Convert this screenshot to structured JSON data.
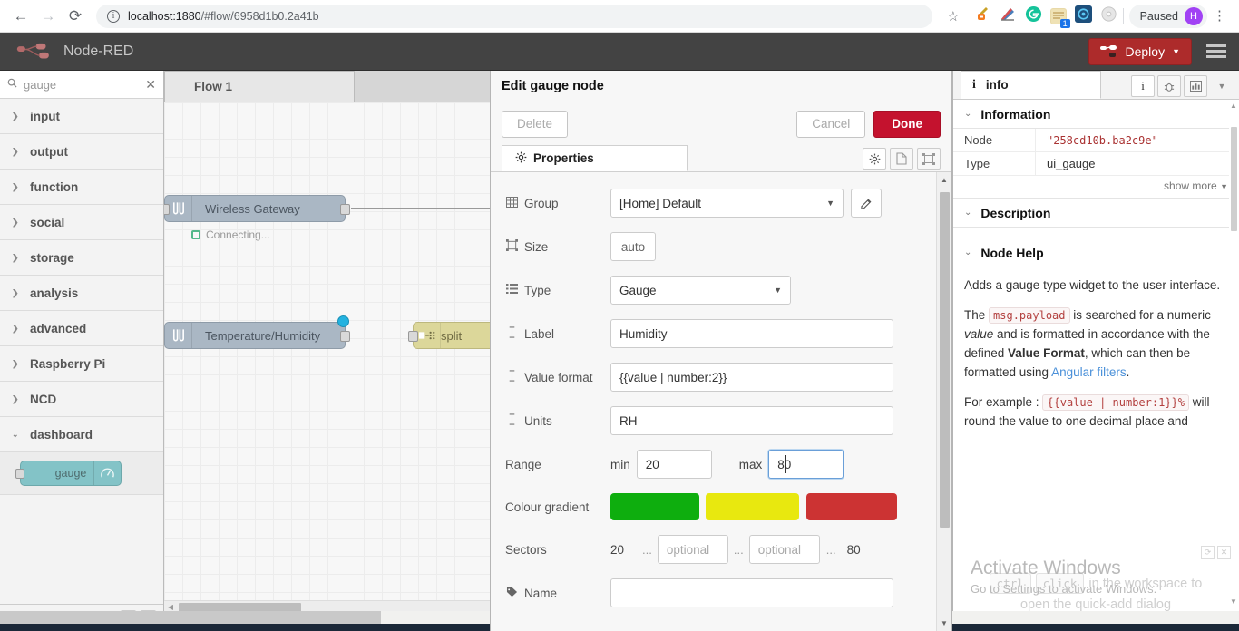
{
  "browser": {
    "back_icon": "back-arrow",
    "forward_icon": "forward-arrow",
    "reload_icon": "reload",
    "url_prefix": "localhost:1880",
    "url_suffix": "/#flow/6958d1b0.2a41b",
    "url_full": "localhost:1880/#flow/6958d1b0.2a41b",
    "star_glyph": "☆",
    "profile_status": "Paused",
    "profile_initial": "H",
    "extension_badge": "1",
    "kebab_glyph": "⋮"
  },
  "header": {
    "title": "Node-RED",
    "deploy_label": "Deploy",
    "deploy_color": "#ad2b2b"
  },
  "palette": {
    "search_value": "gauge",
    "search_clear": "✕",
    "categories": [
      {
        "label": "input",
        "open": false
      },
      {
        "label": "output",
        "open": false
      },
      {
        "label": "function",
        "open": false
      },
      {
        "label": "social",
        "open": false
      },
      {
        "label": "storage",
        "open": false
      },
      {
        "label": "analysis",
        "open": false
      },
      {
        "label": "advanced",
        "open": false
      },
      {
        "label": "Raspberry Pi",
        "open": false
      },
      {
        "label": "NCD",
        "open": false
      },
      {
        "label": "dashboard",
        "open": true
      }
    ],
    "nodes": [
      {
        "label": "gauge",
        "icon": "gauge-icon",
        "color": "#83c3c7"
      }
    ],
    "footer_up": "▲",
    "footer_down": "▼"
  },
  "workspace": {
    "tab_label": "Flow 1",
    "nodes": [
      {
        "label": "Wireless Gateway",
        "status": "Connecting...",
        "color": "#aab7c4"
      },
      {
        "label": "Temperature/Humidity",
        "color": "#aab7c4"
      },
      {
        "label": "split",
        "color": "#dcd79a"
      }
    ]
  },
  "dialog": {
    "title": "Edit gauge node",
    "delete_label": "Delete",
    "cancel_label": "Cancel",
    "done_label": "Done",
    "tab_label": "Properties",
    "fields": {
      "group_label": "Group",
      "group_value": "[Home] Default",
      "size_label": "Size",
      "size_value": "auto",
      "type_label": "Type",
      "type_value": "Gauge",
      "label_label": "Label",
      "label_value": "Humidity",
      "valueformat_label": "Value format",
      "valueformat_value": "{{value | number:2}}",
      "units_label": "Units",
      "units_value": "RH",
      "range_label": "Range",
      "range_min_label": "min",
      "range_min_value": "20",
      "range_max_label": "max",
      "range_max_value": "80",
      "gradient_label": "Colour gradient",
      "gradient_colors": [
        "#0eae0e",
        "#e8e80f",
        "#cc3333"
      ],
      "sectors_label": "Sectors",
      "sectors_start": "20",
      "sectors_end": "80",
      "sectors_optional_placeholder": "optional",
      "sectors_dots": "...",
      "name_label": "Name",
      "name_value": ""
    }
  },
  "info": {
    "tab_label": "info",
    "information_heading": "Information",
    "node_key": "Node",
    "node_value": "\"258cd10b.ba2c9e\"",
    "type_key": "Type",
    "type_value": "ui_gauge",
    "show_more": "show more",
    "description_heading": "Description",
    "nodehelp_heading": "Node Help",
    "help_p1": "Adds a gauge type widget to the user interface.",
    "help_p2_a": "The ",
    "help_p2_code": "msg.payload",
    "help_p2_b": " is searched for a numeric ",
    "help_p2_em": "value",
    "help_p2_c": " and is formatted in accordance with the defined ",
    "help_p2_strong": "Value Format",
    "help_p2_d": ", which can then be formatted using ",
    "help_p2_link": "Angular filters",
    "help_p2_e": ".",
    "help_p3_a": "For example : ",
    "help_p3_code": "{{value | number:1}}%",
    "help_p3_b": "will round the value to one decimal place and"
  },
  "quickadd": {
    "key1": "ctrl",
    "key2": "click",
    "line1_tail": "in the workspace to",
    "line2": "open the quick-add dialog",
    "refresh_icon": "⟳",
    "close_icon": "✕"
  },
  "watermark": {
    "line1": "Activate Windows",
    "line2": "Go to Settings to activate Windows."
  }
}
